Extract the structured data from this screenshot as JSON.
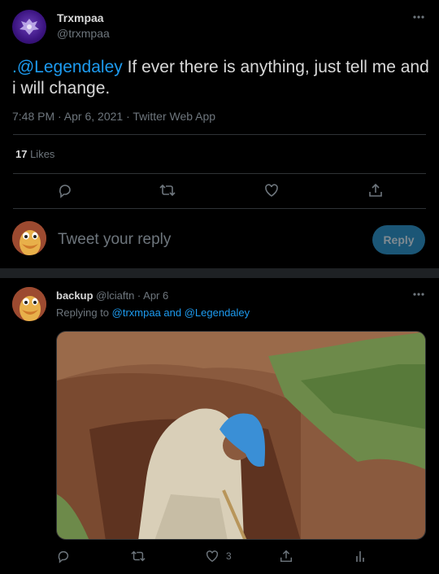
{
  "tweet": {
    "author_name": "Trxmpaa",
    "author_handle": "@trxmpaa",
    "text_mention": ".@Legendaley",
    "text_body": " If ever there is anything, just tell me and i will change.",
    "timestamp": "7:48 PM · Apr 6, 2021 · Twitter Web App",
    "likes_count": "17",
    "likes_label": " Likes"
  },
  "reply_box": {
    "placeholder": "Tweet your reply",
    "button_label": "Reply"
  },
  "reply": {
    "author_name": "backup",
    "author_handle": "@lciaftn",
    "date": " · Apr 6",
    "replying_prefix": "Replying to ",
    "replying_users": "@trxmpaa and @Legendaley",
    "like_count": "3"
  },
  "icons": [
    "more-icon",
    "comment-icon",
    "retweet-icon",
    "like-icon",
    "share-icon",
    "analytics-icon"
  ],
  "colors": {
    "accent": "#1d9bf0",
    "reply_button_bg": "#1b5676",
    "background": "#000000"
  }
}
